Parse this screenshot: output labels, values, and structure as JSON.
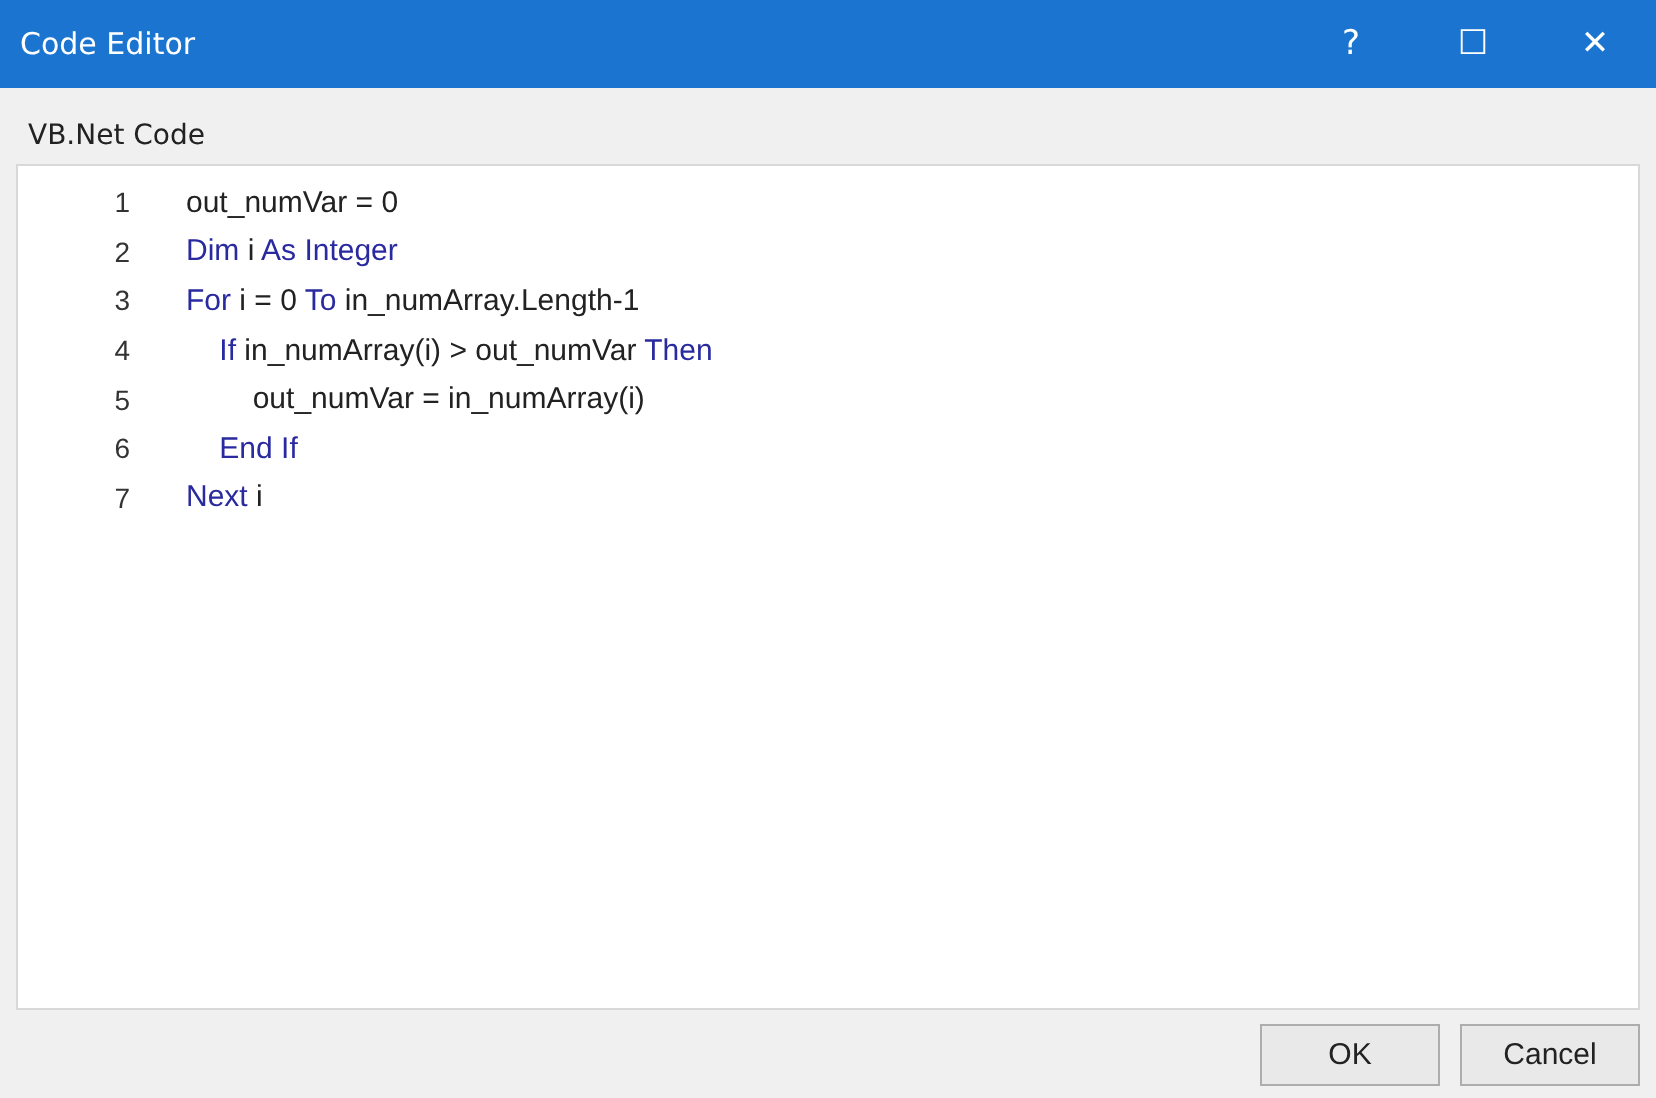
{
  "window": {
    "title": "Code Editor",
    "controls": [
      "?",
      "☐",
      "✕"
    ]
  },
  "label": "VB.Net Code",
  "code_lines": [
    {
      "number": "1",
      "tokens": [
        {
          "text": "out_numVar = 0",
          "kind": "plain"
        }
      ]
    },
    {
      "number": "2",
      "tokens": [
        {
          "text": "Dim",
          "kind": "keyword"
        },
        {
          "text": " i ",
          "kind": "plain"
        },
        {
          "text": "As Integer",
          "kind": "keyword"
        }
      ]
    },
    {
      "number": "3",
      "tokens": [
        {
          "text": "For",
          "kind": "keyword"
        },
        {
          "text": " i = 0 ",
          "kind": "plain"
        },
        {
          "text": "To",
          "kind": "keyword"
        },
        {
          "text": " in_numArray.Length-1",
          "kind": "plain"
        }
      ]
    },
    {
      "number": "4",
      "tokens": [
        {
          "text": "    If",
          "kind": "keyword"
        },
        {
          "text": " in_numArray(i) > out_numVar ",
          "kind": "plain"
        },
        {
          "text": "Then",
          "kind": "keyword"
        }
      ]
    },
    {
      "number": "5",
      "tokens": [
        {
          "text": "        out_numVar = in_numArray(i)",
          "kind": "plain"
        }
      ]
    },
    {
      "number": "6",
      "tokens": [
        {
          "text": "    End If",
          "kind": "keyword"
        }
      ]
    },
    {
      "number": "7",
      "tokens": [
        {
          "text": "Next",
          "kind": "keyword"
        },
        {
          "text": " i",
          "kind": "plain"
        }
      ]
    }
  ],
  "buttons": [
    "OK",
    "Cancel"
  ]
}
